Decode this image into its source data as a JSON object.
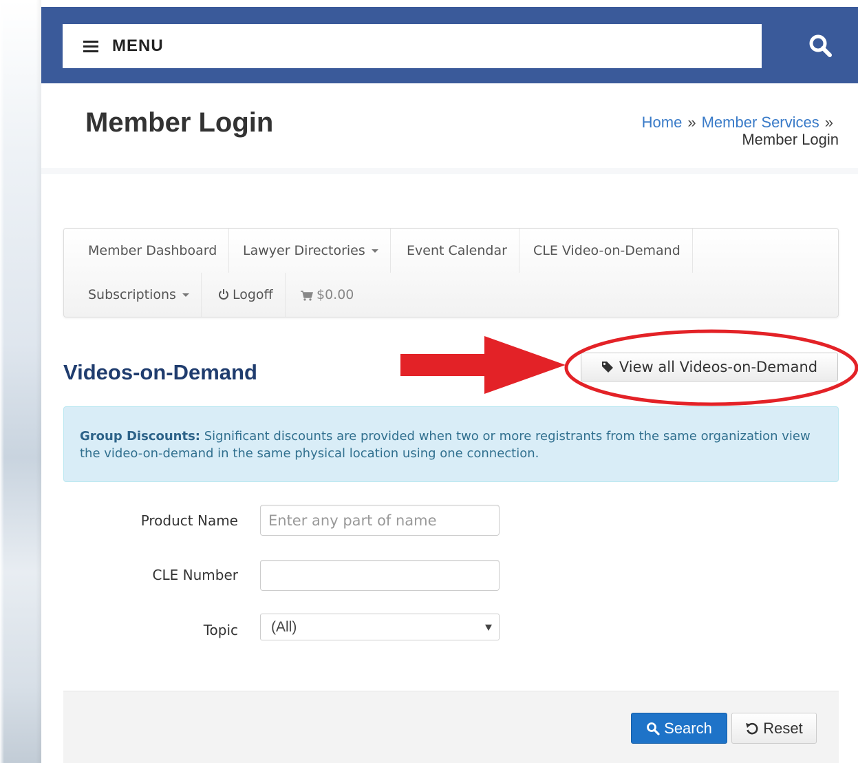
{
  "header": {
    "menu_label": "MENU",
    "menu_icon": "hamburger-icon",
    "search_icon": "search-icon",
    "bar_color": "#3a5a9a"
  },
  "title": {
    "page_title": "Member Login",
    "breadcrumb": {
      "home": "Home",
      "separator": "»",
      "member_services": "Member Services",
      "current": "Member Login"
    }
  },
  "subnav": {
    "items": [
      {
        "label": "Member Dashboard"
      },
      {
        "label": "Lawyer Directories",
        "dropdown": true
      },
      {
        "label": "Event Calendar"
      },
      {
        "label": "CLE Video-on-Demand"
      },
      {
        "label": "Subscriptions",
        "dropdown": true
      },
      {
        "label": "Logoff",
        "icon": "power-icon"
      },
      {
        "label": "$0.00",
        "icon": "cart-icon"
      }
    ]
  },
  "section": {
    "title": "Videos-on-Demand",
    "view_all_label": "View all Videos-on-Demand",
    "view_all_icon": "tag-icon",
    "annotation_color": "#e32227"
  },
  "alert": {
    "strong": "Group Discounts:",
    "text": " Significant discounts are provided when two or more registrants from the same organization view the video-on-demand in the same physical location using one connection."
  },
  "form": {
    "product_name_label": "Product Name",
    "product_name_placeholder": "Enter any part of name",
    "product_name_value": "",
    "cle_number_label": "CLE Number",
    "cle_number_value": "",
    "topic_label": "Topic",
    "topic_selected": "(All)"
  },
  "actions": {
    "search_label": "Search",
    "search_icon": "search-icon",
    "reset_label": "Reset",
    "reset_icon": "undo-icon",
    "primary_color": "#1e73c8"
  }
}
